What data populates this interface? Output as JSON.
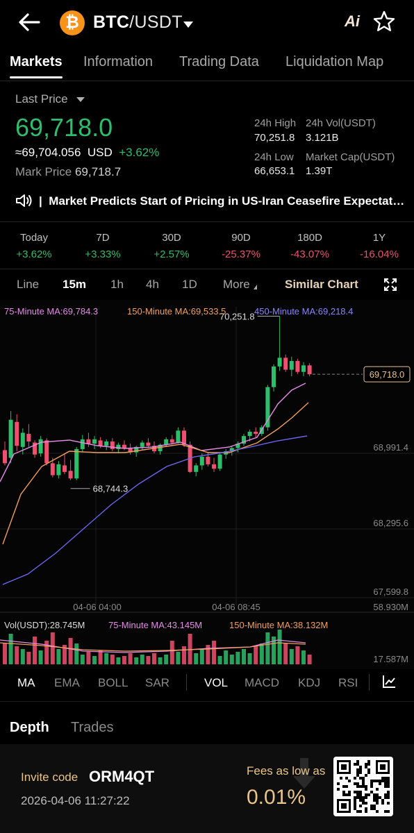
{
  "header": {
    "coin_symbol": "₿",
    "base": "BTC",
    "quote": "/USDT",
    "ai_label": "Ai",
    "back_icon": "back-arrow-icon",
    "star_icon": "star-icon"
  },
  "tabs": [
    "Markets",
    "Information",
    "Trading Data",
    "Liquidation Map"
  ],
  "price": {
    "last_label": "Last Price",
    "last": "69,718.0",
    "usd": "≈69,704.056",
    "usd_unit": "USD",
    "change": "+3.62%",
    "mark_label": "Mark Price",
    "mark": "69,718.7"
  },
  "stats": {
    "high_label": "24h High",
    "high": "70,251.8",
    "vol_label": "24h Vol(USDT)",
    "vol": "3.121B",
    "low_label": "24h Low",
    "low": "66,653.1",
    "cap_label": "Market Cap(USDT)",
    "cap": "1.39T"
  },
  "news": {
    "separator": "|",
    "text": "Market Predicts Start of Pricing in US-Iran Ceasefire Expectations"
  },
  "performance": [
    {
      "label": "Today",
      "value": "+3.62%",
      "dir": "up"
    },
    {
      "label": "7D",
      "value": "+3.33%",
      "dir": "up"
    },
    {
      "label": "30D",
      "value": "+2.57%",
      "dir": "up"
    },
    {
      "label": "90D",
      "value": "-25.37%",
      "dir": "down"
    },
    {
      "label": "180D",
      "value": "-43.07%",
      "dir": "down"
    },
    {
      "label": "1Y",
      "value": "-16.04%",
      "dir": "down"
    }
  ],
  "timeframes": {
    "items": [
      "Line",
      "15m",
      "1h",
      "4h",
      "1D"
    ],
    "more": "More",
    "similar": "Similar Chart"
  },
  "ma_legend": {
    "ma75": "75-Minute MA:69,784.3",
    "ma150": "150-Minute MA:69,533.5",
    "ma450": "450-Minute MA:69,218.4"
  },
  "colors": {
    "up": "#2ebd6b",
    "down": "#f0506e",
    "ma75": "#e58ce6",
    "ma150": "#f2a05a",
    "ma450": "#6e66f0",
    "accent": "#e9c58a"
  },
  "chart_data": {
    "type": "candlestick",
    "y_axis_labels": [
      "68,991.4",
      "68,295.6",
      "67,599.8"
    ],
    "x_axis_labels": [
      "04-06 04:00",
      "04-06 08:45"
    ],
    "high_marker": "70,251.8",
    "low_marker": "68,744.3",
    "current_price_tag": "69,718.0",
    "volume": {
      "label": "Vol(USDT):28.745M",
      "ma75": "75-Minute MA:43.145M",
      "ma150": "150-Minute MA:38.132M",
      "max_label": "58.930M",
      "min_label": "17.587M"
    }
  },
  "indicators": {
    "main": [
      "MA",
      "EMA",
      "BOLL",
      "SAR"
    ],
    "sub": [
      "VOL",
      "MACD",
      "KDJ",
      "RSI"
    ]
  },
  "bottom_tabs": [
    "Depth",
    "Trades"
  ],
  "promo": {
    "invite_label": "Invite code",
    "invite_code": "ORM4QT",
    "timestamp": "2026-04-06 11:27:22",
    "fees_label": "Fees as low as",
    "fees_value": "0.01%"
  }
}
